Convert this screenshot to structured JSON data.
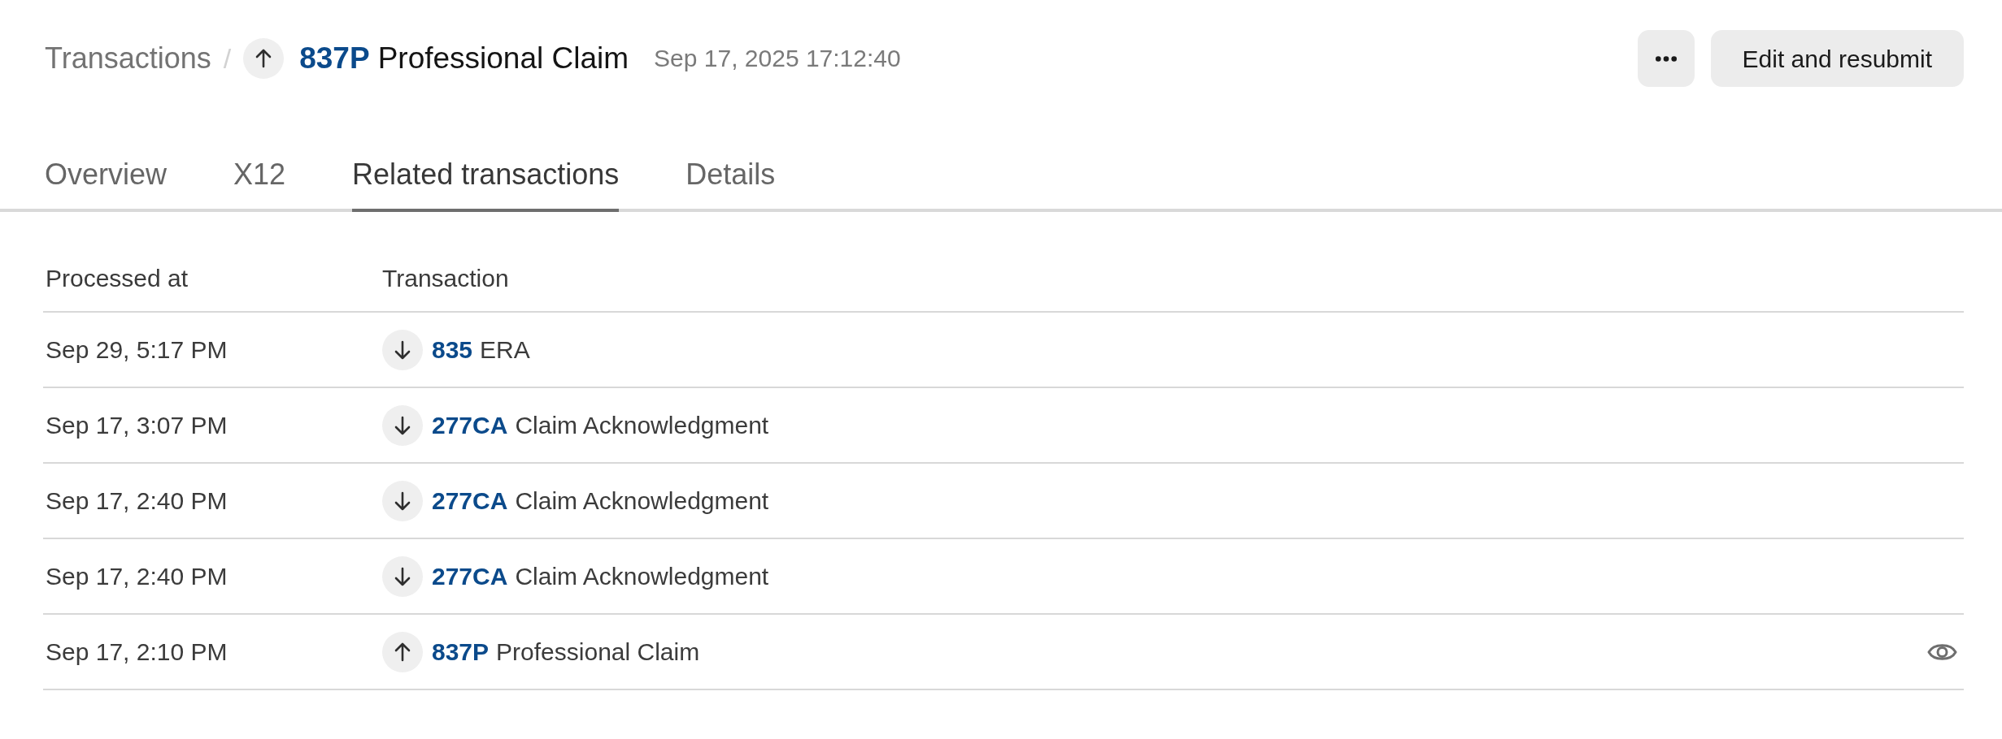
{
  "breadcrumb": {
    "parent": "Transactions",
    "separator": "/",
    "current": {
      "kind": "up",
      "code": "837P",
      "name": "Professional Claim"
    },
    "timestamp": "Sep 17, 2025 17:12:40"
  },
  "actions": [
    {
      "kind": "more"
    },
    {
      "kind": "text",
      "label": "Edit and resubmit"
    }
  ],
  "tabs": [
    {
      "label": "Overview",
      "selected": false
    },
    {
      "label": "X12",
      "selected": false
    },
    {
      "label": "Related transactions",
      "selected": true
    },
    {
      "label": "Details",
      "selected": false
    }
  ],
  "table": {
    "columns": [
      "Processed at",
      "Transaction"
    ],
    "rows": [
      {
        "processed_at": "Sep 29, 5:17 PM",
        "kind": "down",
        "code": "835",
        "name": "ERA",
        "current": false
      },
      {
        "processed_at": "Sep 17, 3:07 PM",
        "kind": "down",
        "code": "277CA",
        "name": "Claim Acknowledgment",
        "current": false
      },
      {
        "processed_at": "Sep 17, 2:40 PM",
        "kind": "down",
        "code": "277CA",
        "name": "Claim Acknowledgment",
        "current": false
      },
      {
        "processed_at": "Sep 17, 2:40 PM",
        "kind": "down",
        "code": "277CA",
        "name": "Claim Acknowledgment",
        "current": false
      },
      {
        "processed_at": "Sep 17, 2:10 PM",
        "kind": "up",
        "code": "837P",
        "name": "Professional Claim",
        "current": true
      }
    ]
  }
}
